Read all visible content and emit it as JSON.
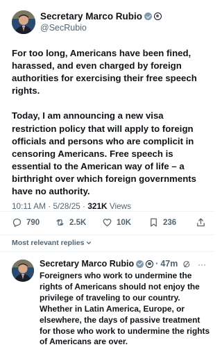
{
  "tweet": {
    "author_name": "Secretary Marco Rubio",
    "handle": "@SecRubio",
    "text": "For too long, Americans have been fined, harassed, and even charged by foreign authorities for exercising their free speech rights.\n\nToday, I am announcing a new visa restriction policy that will apply to foreign officials and persons who are complicit in censoring Americans. Free speech is essential to the American way of life – a birthright over which foreign governments have no authority.",
    "time": "10:11 AM",
    "date": "5/28/25",
    "views_count": "321K",
    "views_label": "Views",
    "replies": "790",
    "reposts": "2.5K",
    "likes": "10K",
    "bookmarks": "236"
  },
  "replies_sort_label": "Most relevant replies",
  "reply": {
    "author_name": "Secretary Marco Rubio",
    "age": "47m",
    "text": "Foreigners who work to undermine the rights of Americans should not enjoy the privilege of traveling to our country. Whether in Latin America, Europe, or elsewhere, the days of passive treatment for those who work to undermine the rights of Americans are over."
  },
  "icons": {
    "verified": "verified-badge-icon",
    "affiliation": "government-seal-icon",
    "reply": "reply-icon",
    "repost": "repost-icon",
    "like": "like-icon",
    "bookmark": "bookmark-icon",
    "share": "share-icon",
    "chevron": "chevron-down-icon",
    "grok": "grok-icon",
    "more": "more-icon"
  },
  "colors": {
    "text_primary": "#0f1419",
    "text_secondary": "#536471",
    "divider": "#eff3f4",
    "badge": "#829aab"
  }
}
